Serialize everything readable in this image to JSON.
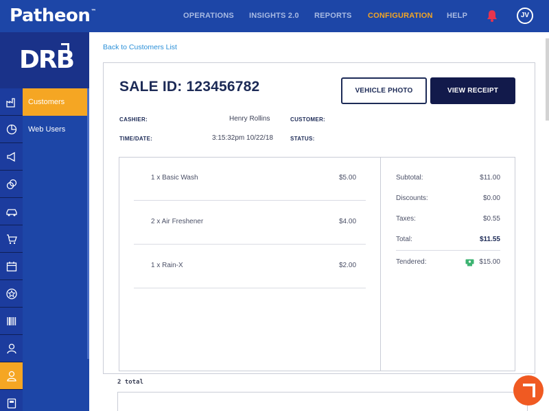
{
  "app": {
    "brand": "Patheon",
    "brand_mark": "™",
    "logo": "DRB"
  },
  "topnav": {
    "items": [
      {
        "label": "OPERATIONS",
        "active": false
      },
      {
        "label": "INSIGHTS 2.0",
        "active": false
      },
      {
        "label": "REPORTS",
        "active": false
      },
      {
        "label": "CONFIGURATION",
        "active": true
      },
      {
        "label": "HELP",
        "active": false
      }
    ],
    "bell_icon": "bell-icon",
    "bell_color": "#e8344e",
    "avatar_initials": "JV"
  },
  "sidebar": {
    "icons": [
      "factory-icon",
      "pie-chart-icon",
      "megaphone-icon",
      "coins-icon",
      "car-wash-icon",
      "cart-icon",
      "calendar-icon",
      "star-badge-icon",
      "barcode-icon",
      "cashier-icon",
      "person-icon",
      "register-icon"
    ],
    "active_icon_index": 10,
    "subnav": [
      {
        "label": "Customers",
        "active": true
      },
      {
        "label": "Web Users",
        "active": false
      }
    ]
  },
  "main": {
    "back_link": "Back to Customers List",
    "sale_title": "SALE ID: 123456782",
    "buttons": {
      "vehicle_photo": "VEHICLE PHOTO",
      "view_receipt": "VIEW RECEIPT"
    },
    "meta": {
      "cashier_label": "CASHIER:",
      "cashier_value": "Henry Rollins",
      "customer_label": "CUSTOMER:",
      "customer_value": "",
      "timedate_label": "TIME/DATE:",
      "timedate_value": "3:15:32pm  10/22/18",
      "status_label": "STATUS:",
      "status_value": ""
    },
    "line_items": [
      {
        "desc": "1  x  Basic Wash",
        "price": "$5.00"
      },
      {
        "desc": "2  x  Air Freshener",
        "price": "$4.00"
      },
      {
        "desc": "1  x  Rain-X",
        "price": "$2.00"
      }
    ],
    "summary": {
      "subtotal_label": "Subtotal:",
      "subtotal": "$11.00",
      "discounts_label": "Discounts:",
      "discounts": "$0.00",
      "taxes_label": "Taxes:",
      "taxes": "$0.55",
      "total_label": "Total:",
      "total": "$11.55",
      "tendered_label": "Tendered:",
      "tendered": "$15.00",
      "tendered_icon": "cash-icon"
    },
    "total_count": "2 total"
  },
  "colors": {
    "nav_blue": "#1d46a7",
    "accent_orange": "#f5a623",
    "dark_navy": "#121a4b",
    "help_orange": "#f05a22"
  }
}
